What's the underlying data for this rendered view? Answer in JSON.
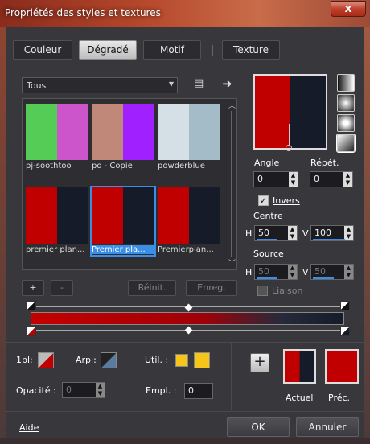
{
  "window": {
    "title": "Propriétés des styles et textures",
    "close_glyph": "x"
  },
  "tabs": [
    {
      "label": "Couleur"
    },
    {
      "label": "Dégradé",
      "active": true
    },
    {
      "label": "Motif"
    },
    {
      "label": "Texture"
    }
  ],
  "category": {
    "selected": "Tous"
  },
  "gradients": [
    {
      "name": "pj-soothtoo",
      "left": "#55cc55",
      "right": "#cc55cc"
    },
    {
      "name": "po - Copie",
      "left": "#c08878",
      "right": "#a020ff"
    },
    {
      "name": "powderblue",
      "left": "#d0dde4",
      "right": "#9fb8c4"
    },
    {
      "name": "premier plan...",
      "left": "#c00000",
      "right": "#161b2a"
    },
    {
      "name": "Premier pla...",
      "left": "#c00000",
      "right": "#161b2a",
      "selected": true
    },
    {
      "name": "Premierplan...",
      "left": "#c00000",
      "right": "#161b2a"
    }
  ],
  "list_buttons": {
    "add": "+",
    "remove": "-",
    "reset": "Réinit.",
    "save": "Enreg."
  },
  "settings": {
    "angle_label": "Angle",
    "angle_value": "0",
    "repeat_label": "Répét.",
    "repeat_value": "0",
    "invert_label": "Invers",
    "invert_checked": true,
    "center_label": "Centre",
    "center_h": "50",
    "center_v": "100",
    "source_label": "Source",
    "source_h": "50",
    "source_v": "50",
    "link_label": "Liaison",
    "h_letter": "H",
    "v_letter": "V"
  },
  "bottom": {
    "fg_label": "1pl:",
    "bg_label": "Arpl:",
    "use_label": "Util. :",
    "opacity_label": "Opacité :",
    "opacity_value": "0",
    "position_label": "Empl. :",
    "position_value": "0",
    "add_glyph": "+",
    "current_label": "Actuel",
    "previous_label": "Préc."
  },
  "footer": {
    "help": "Aide",
    "ok": "OK",
    "cancel": "Annuler"
  },
  "colors": {
    "red": "#c00000",
    "navy": "#161b2a",
    "accent": "#3a8ee6",
    "yellow": "#f5c518"
  }
}
